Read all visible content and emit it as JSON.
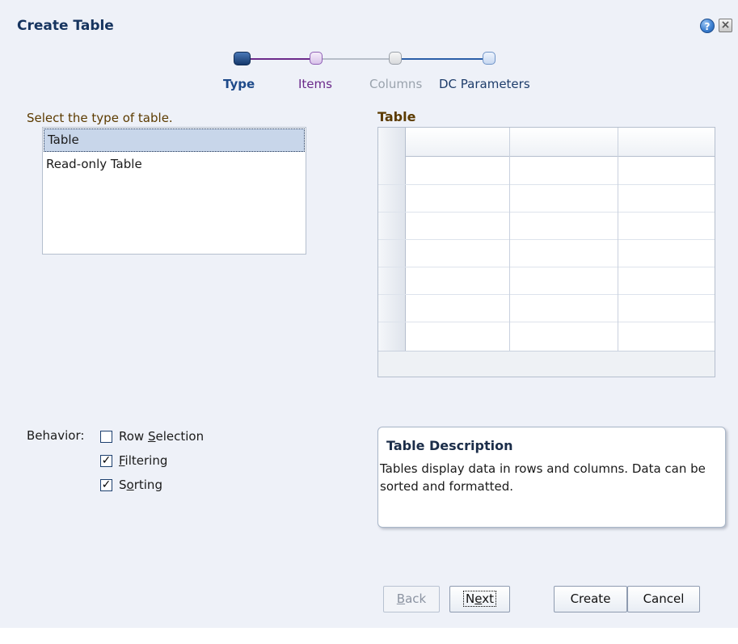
{
  "dialog": {
    "title": "Create Table",
    "help_icon": "help-icon",
    "close_icon": "close-icon"
  },
  "train": {
    "stops": [
      {
        "label": "Type",
        "state": "current",
        "color": "#1e4a8a"
      },
      {
        "label": "Items",
        "state": "visited",
        "color": "#6b2a8a"
      },
      {
        "label": "Columns",
        "state": "disabled",
        "color": "#9aa3ad"
      },
      {
        "label": "DC Parameters",
        "state": "unvisited",
        "color": "#1e3d6b"
      }
    ]
  },
  "type_section": {
    "prompt": "Select the type of table.",
    "options": [
      "Table",
      "Read-only Table"
    ],
    "selected": "Table"
  },
  "preview": {
    "label": "Table"
  },
  "behavior": {
    "label": "Behavior:",
    "options": [
      {
        "label": "Row Selection",
        "checked": false
      },
      {
        "label": "Filtering",
        "checked": true
      },
      {
        "label": "Sorting",
        "checked": true
      }
    ]
  },
  "description": {
    "title": "Table Description",
    "text": "Tables display data in rows and columns. Data can be sorted and formatted."
  },
  "buttons": {
    "back": "Back",
    "next": "Next",
    "create": "Create",
    "cancel": "Cancel"
  },
  "colors": {
    "background": "#eef1f8",
    "title": "#16345f",
    "section_label": "#5c3b00"
  }
}
